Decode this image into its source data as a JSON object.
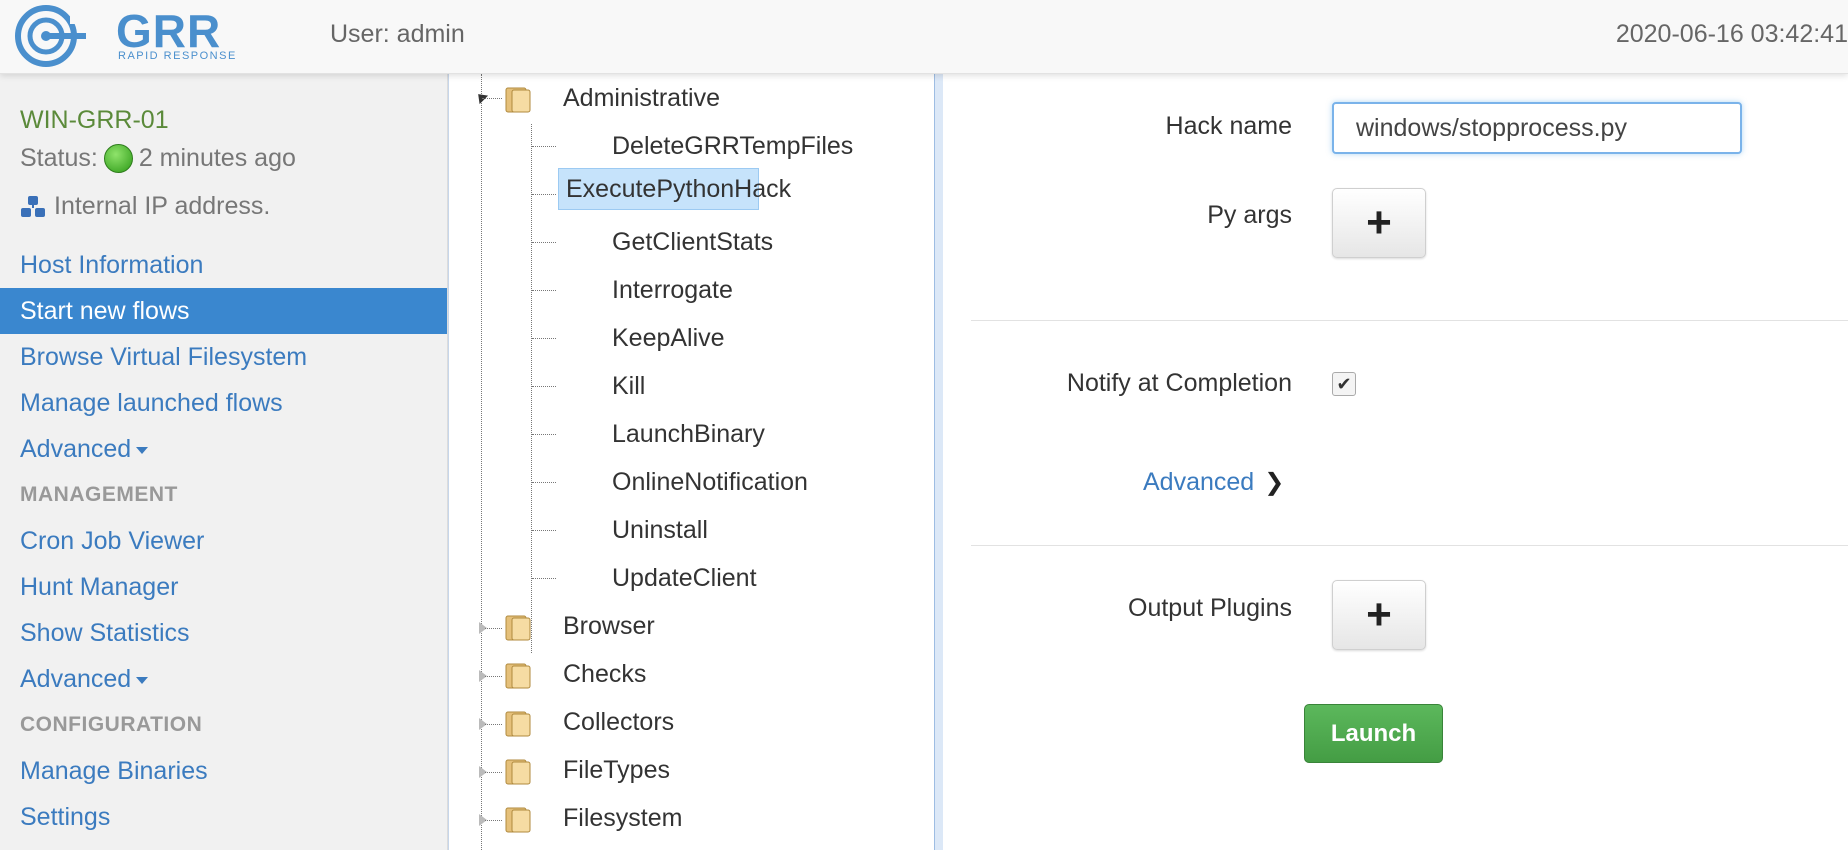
{
  "header": {
    "logo_text": "GRR",
    "logo_subtitle": "RAPID RESPONSE",
    "user_label": "User: admin",
    "datetime": "2020-06-16 03:42:41"
  },
  "client": {
    "name": "WIN-GRR-01",
    "status_prefix": "Status:",
    "status_time": "2 minutes ago",
    "ip_text": "Internal IP address."
  },
  "sidebar": {
    "items": [
      {
        "label": "Host Information"
      },
      {
        "label": "Start new flows"
      },
      {
        "label": "Browse Virtual Filesystem"
      },
      {
        "label": "Manage launched flows"
      },
      {
        "label": "Advanced"
      },
      {
        "label": "MANAGEMENT"
      },
      {
        "label": "Cron Job Viewer"
      },
      {
        "label": "Hunt Manager"
      },
      {
        "label": "Show Statistics"
      },
      {
        "label": "Advanced"
      },
      {
        "label": "CONFIGURATION"
      },
      {
        "label": "Manage Binaries"
      },
      {
        "label": "Settings"
      }
    ]
  },
  "tree": {
    "root": "Administrative",
    "children": [
      {
        "label": "DeleteGRRTempFiles"
      },
      {
        "label": "ExecutePythonHack"
      },
      {
        "label": "GetClientStats"
      },
      {
        "label": "Interrogate"
      },
      {
        "label": "KeepAlive"
      },
      {
        "label": "Kill"
      },
      {
        "label": "LaunchBinary"
      },
      {
        "label": "OnlineNotification"
      },
      {
        "label": "Uninstall"
      },
      {
        "label": "UpdateClient"
      }
    ],
    "folders": [
      {
        "label": "Browser"
      },
      {
        "label": "Checks"
      },
      {
        "label": "Collectors"
      },
      {
        "label": "FileTypes"
      },
      {
        "label": "Filesystem"
      }
    ]
  },
  "form": {
    "hack_name_label": "Hack name",
    "hack_name_value": "windows/stopprocess.py",
    "py_args_label": "Py args",
    "notify_label": "Notify at Completion",
    "notify_checked": true,
    "advanced_label": "Advanced",
    "output_plugins_label": "Output Plugins",
    "launch_label": "Launch",
    "plus_glyph": "+",
    "check_glyph": "✔"
  },
  "colors": {
    "accent": "#3a87cf",
    "link": "#3b7bbf",
    "launch": "#5cb85c",
    "client_name": "#5b8a3a"
  }
}
